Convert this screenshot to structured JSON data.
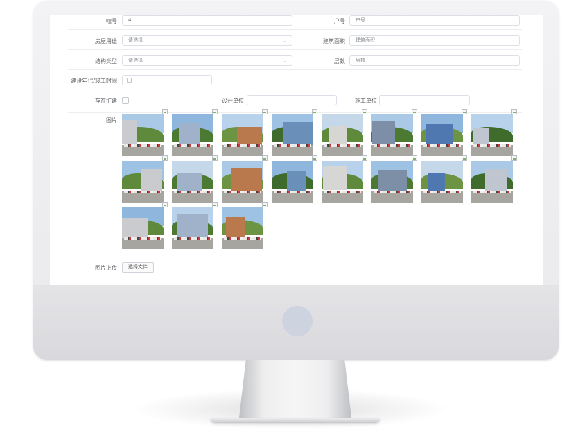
{
  "form": {
    "building_no": {
      "label": "幢号",
      "value": "4"
    },
    "household": {
      "label": "户号",
      "placeholder": "户号"
    },
    "house_use": {
      "label": "房屋用途",
      "placeholder": "请选择"
    },
    "building_area": {
      "label": "建筑面积",
      "placeholder": "建筑面积"
    },
    "structure_type": {
      "label": "结构类型",
      "placeholder": "请选择"
    },
    "floors": {
      "label": "层数",
      "placeholder": "层数"
    },
    "build_year": {
      "label": "建设年代/竣工时间"
    },
    "expansion": {
      "label": "存在扩建"
    },
    "design_unit": {
      "label": "设计单位"
    },
    "construction_unit": {
      "label": "施工单位"
    },
    "photos": {
      "label": "图片",
      "count": 19
    },
    "upload": {
      "label": "图片上传",
      "button": "选择文件"
    }
  }
}
